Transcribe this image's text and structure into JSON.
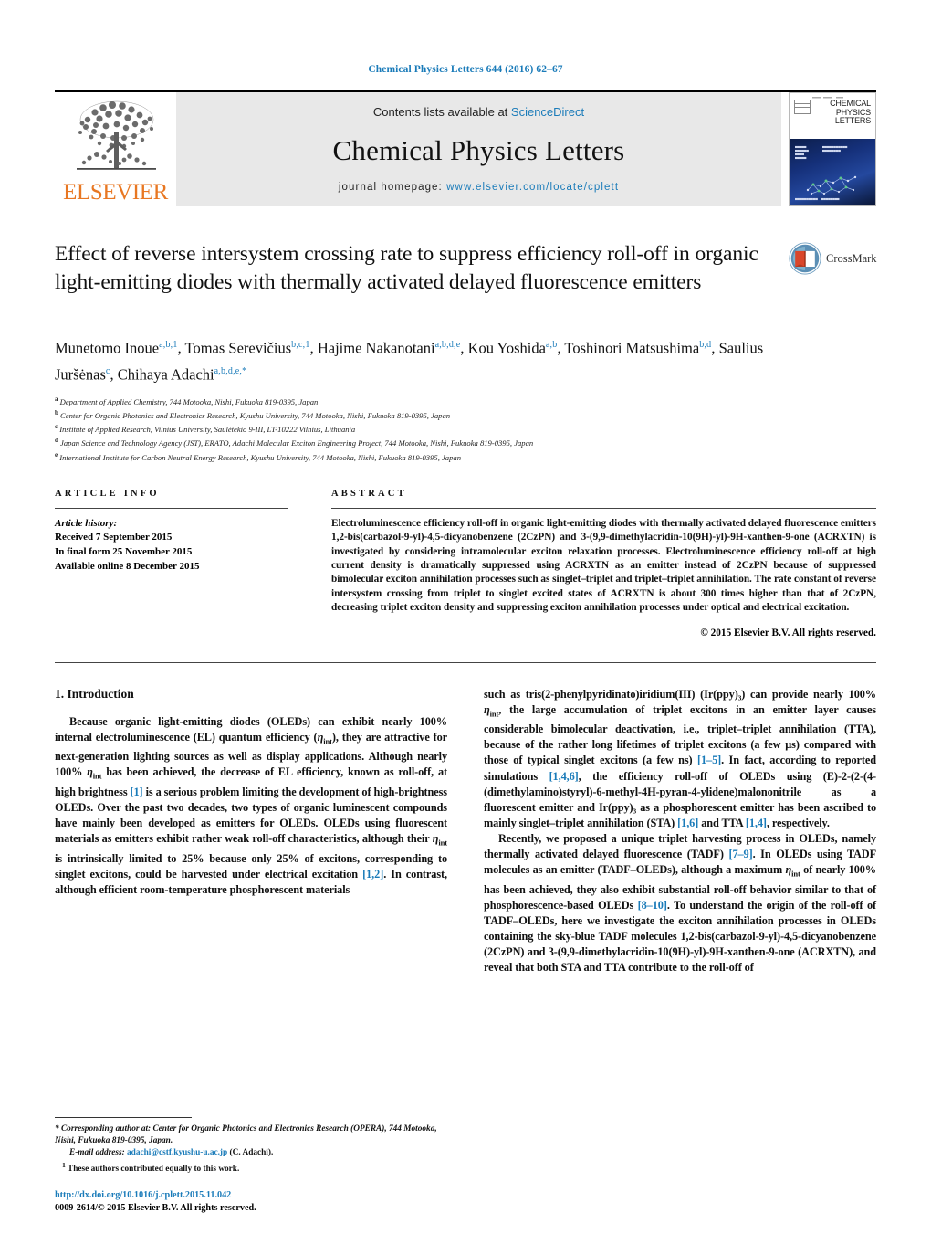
{
  "running_head": "Chemical Physics Letters 644 (2016) 62–67",
  "masthead": {
    "publisher": "ELSEVIER",
    "contents_prefix": "Contents lists available at ",
    "contents_link": "ScienceDirect",
    "journal_name": "Chemical Physics Letters",
    "homepage_prefix": "journal homepage: ",
    "homepage_url": "www.elsevier.com/locate/cplett",
    "cover_title_line1": "CHEMICAL",
    "cover_title_line2": "PHYSICS",
    "cover_title_line3": "LETTERS"
  },
  "article": {
    "title": "Effect of reverse intersystem crossing rate to suppress efficiency roll-off in organic light-emitting diodes with thermally activated delayed fluorescence emitters",
    "crossmark_label": "CrossMark",
    "authors": [
      {
        "name": "Munetomo Inoue",
        "marks": "a,b,1",
        "sep": ", "
      },
      {
        "name": "Tomas Serevičius",
        "marks": "b,c,1",
        "sep": ", "
      },
      {
        "name": "Hajime Nakanotani",
        "marks": "a,b,d,e",
        "sep": ", "
      },
      {
        "name": "Kou Yoshida",
        "marks": "a,b",
        "sep": ", "
      },
      {
        "name": "Toshinori Matsushima",
        "marks": "b,d",
        "sep": ", "
      },
      {
        "name": "Saulius Juršėnas",
        "marks": "c",
        "sep": ", "
      },
      {
        "name": "Chihaya Adachi",
        "marks": "a,b,d,e,*",
        "sep": ""
      }
    ],
    "affiliations": [
      {
        "mark": "a",
        "text": "Department of Applied Chemistry, 744 Motooka, Nishi, Fukuoka 819-0395, Japan"
      },
      {
        "mark": "b",
        "text": "Center for Organic Photonics and Electronics Research, Kyushu University, 744 Motooka, Nishi, Fukuoka 819-0395, Japan"
      },
      {
        "mark": "c",
        "text": "Institute of Applied Research, Vilnius University, Saulėtekio 9-III, LT-10222 Vilnius, Lithuania"
      },
      {
        "mark": "d",
        "text": "Japan Science and Technology Agency (JST), ERATO, Adachi Molecular Exciton Engineering Project, 744 Motooka, Nishi, Fukuoka 819-0395, Japan"
      },
      {
        "mark": "e",
        "text": "International Institute for Carbon Neutral Energy Research, Kyushu University, 744 Motooka, Nishi, Fukuoka 819-0395, Japan"
      }
    ]
  },
  "info": {
    "heading": "ARTICLE INFO",
    "history_label": "Article history:",
    "history": [
      "Received 7 September 2015",
      "In final form 25 November 2015",
      "Available online 8 December 2015"
    ]
  },
  "abstract": {
    "heading": "ABSTRACT",
    "text": "Electroluminescence efficiency roll-off in organic light-emitting diodes with thermally activated delayed fluorescence emitters 1,2-bis(carbazol-9-yl)-4,5-dicyanobenzene (2CzPN) and 3-(9,9-dimethylacridin-10(9H)-yl)-9H-xanthen-9-one (ACRXTN) is investigated by considering intramolecular exciton relaxation processes. Electroluminescence efficiency roll-off at high current density is dramatically suppressed using ACRXTN as an emitter instead of 2CzPN because of suppressed bimolecular exciton annihilation processes such as singlet–triplet and triplet–triplet annihilation. The rate constant of reverse intersystem crossing from triplet to singlet excited states of ACRXTN is about 300 times higher than that of 2CzPN, decreasing triplet exciton density and suppressing exciton annihilation processes under optical and electrical excitation.",
    "copyright": "© 2015 Elsevier B.V. All rights reserved."
  },
  "body": {
    "section_number_title": "1. Introduction",
    "left_paragraph_1": "Because organic light-emitting diodes (OLEDs) can exhibit nearly 100% internal electroluminescence (EL) quantum efficiency (η<sub>int</sub>), they are attractive for next-generation lighting sources as well as display applications. Although nearly 100% η<sub>int</sub> has been achieved, the decrease of EL efficiency, known as roll-off, at high brightness [1] is a serious problem limiting the development of high-brightness OLEDs. Over the past two decades, two types of organic luminescent compounds have mainly been developed as emitters for OLEDs. OLEDs using fluorescent materials as emitters exhibit rather weak roll-off characteristics, although their η<sub>int</sub> is intrinsically limited to 25% because only 25% of excitons, corresponding to singlet excitons, could be harvested under electrical excitation [1,2]. In contrast, although efficient room-temperature phosphorescent materials",
    "right_paragraph_1": "such as tris(2-phenylpyridinato)iridium(III) (Ir(ppy)₃) can provide nearly 100% η<sub>int</sub>, the large accumulation of triplet excitons in an emitter layer causes considerable bimolecular deactivation, i.e., triplet–triplet annihilation (TTA), because of the rather long lifetimes of triplet excitons (a few μs) compared with those of typical singlet excitons (a few ns) [1–5]. In fact, according to reported simulations [1,4,6], the efficiency roll-off of OLEDs using (E)-2-(2-(4-(dimethylamino)styryl)-6-methyl-4H-pyran-4-ylidene)malononitrile as a fluorescent emitter and Ir(ppy)₃ as a phosphorescent emitter has been ascribed to mainly singlet–triplet annihilation (STA) [1,6] and TTA [1,4], respectively.",
    "right_paragraph_2": "Recently, we proposed a unique triplet harvesting process in OLEDs, namely thermally activated delayed fluorescence (TADF) [7–9]. In OLEDs using TADF molecules as an emitter (TADF–OLEDs), although a maximum η<sub>int</sub> of nearly 100% has been achieved, they also exhibit substantial roll-off behavior similar to that of phosphorescence-based OLEDs [8–10]. To understand the origin of the roll-off of TADF–OLEDs, here we investigate the exciton annihilation processes in OLEDs containing the sky-blue TADF molecules 1,2-bis(carbazol-9-yl)-4,5-dicyanobenzene (2CzPN) and 3-(9,9-dimethylacridin-10(9H)-yl)-9H-xanthen-9-one (ACRXTN), and reveal that both STA and TTA contribute to the roll-off of"
  },
  "footnotes": {
    "corresponding": "* Corresponding author at: Center for Organic Photonics and Electronics Research (OPERA), 744 Motooka, Nishi, Fukuoka 819-0395, Japan.",
    "email_label": "E-mail address:",
    "email": "adachi@cstf.kyushu-u.ac.jp",
    "email_suffix": "(C. Adachi).",
    "equal_contrib": "1  These authors contributed equally to this work.",
    "doi": "http://dx.doi.org/10.1016/j.cplett.2015.11.042",
    "issn_copyright": "0009-2614/© 2015 Elsevier B.V. All rights reserved."
  },
  "colors": {
    "link": "#1a7bb9",
    "elsevier_orange": "#E87722",
    "masthead_grey": "#e8e8e8"
  }
}
